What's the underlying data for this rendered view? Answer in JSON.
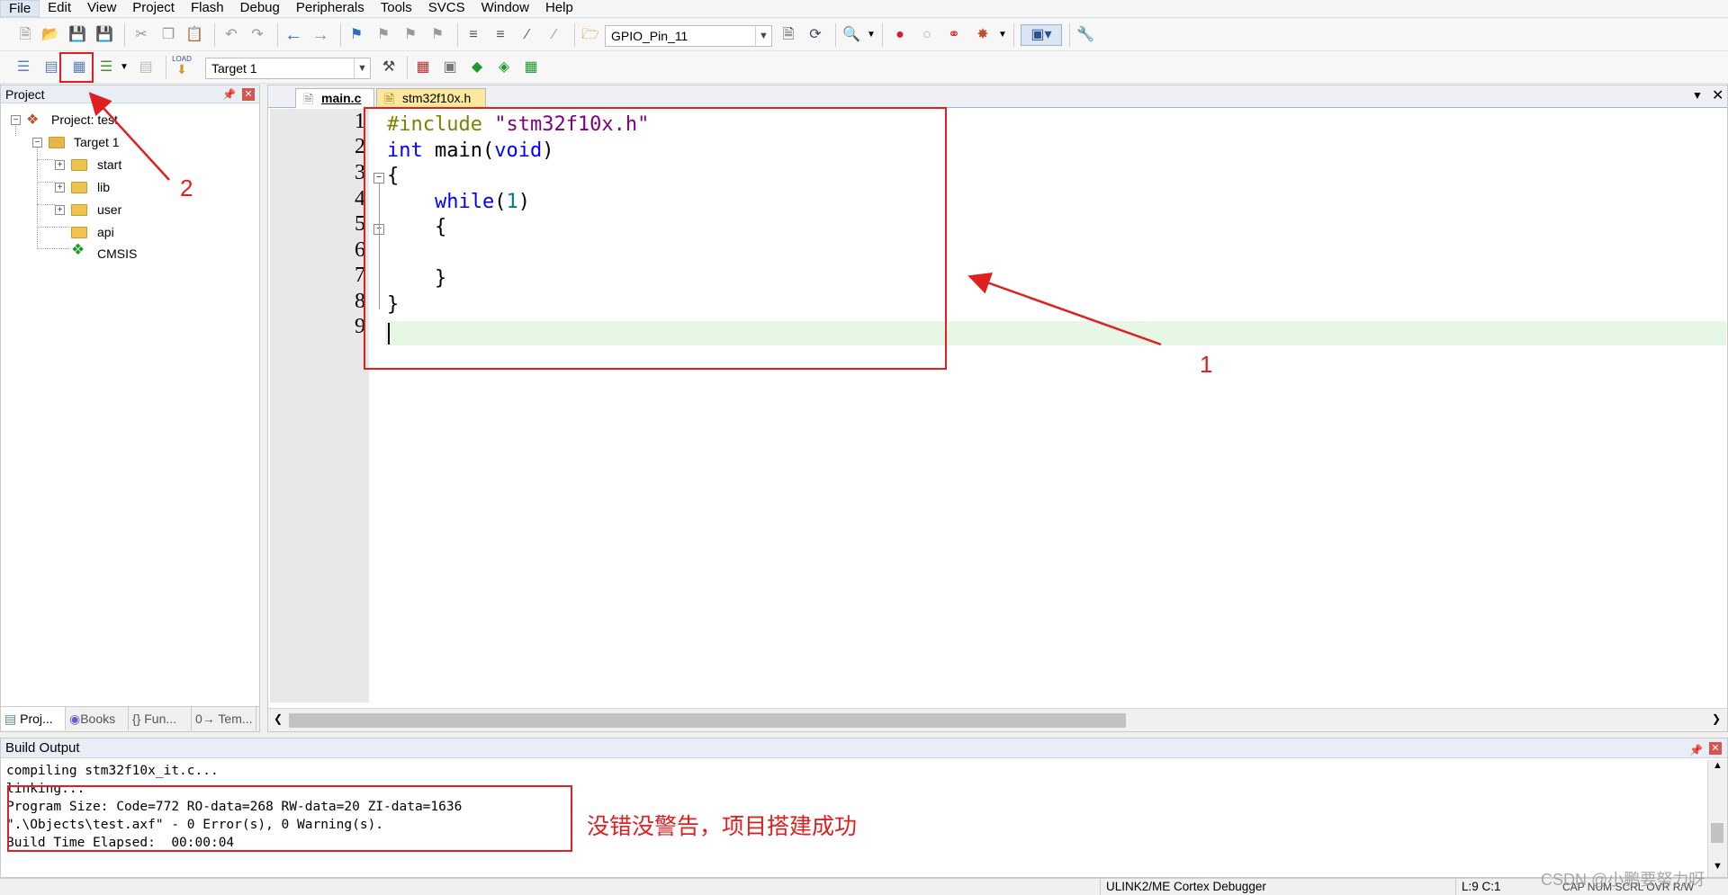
{
  "menu": [
    "File",
    "Edit",
    "View",
    "Project",
    "Flash",
    "Debug",
    "Peripherals",
    "Tools",
    "SVCS",
    "Window",
    "Help"
  ],
  "toolbar": {
    "find_combo_value": "GPIO_Pin_11",
    "target_combo_value": "Target 1",
    "load_label": "LOAD"
  },
  "project_panel": {
    "title": "Project",
    "root": "Project: test",
    "target": "Target 1",
    "groups": [
      "start",
      "lib",
      "user",
      "api"
    ],
    "cmsis": "CMSIS",
    "tabs": [
      "Proj...",
      "Books",
      "{} Fun...",
      "0→ Tem..."
    ]
  },
  "editor": {
    "tabs": [
      "main.c",
      "stm32f10x.h"
    ],
    "active_tab": "main.c",
    "line_numbers": [
      "1",
      "2",
      "3",
      "4",
      "5",
      "6",
      "7",
      "8",
      "9"
    ],
    "code": {
      "l1_directive": "#include ",
      "l1_file": "\"stm32f10x.h\"",
      "l2_int": "int",
      "l2_mid": " main(",
      "l2_void": "void",
      "l2_end": ")",
      "l3": "{",
      "l4_while": "while",
      "l4_open": "(",
      "l4_num": "1",
      "l4_close": ")",
      "l5": "{",
      "l7": "}",
      "l8": "}"
    }
  },
  "build_output": {
    "title": "Build Output",
    "lines": [
      "compiling stm32f10x_it.c...",
      "linking...",
      "Program Size: Code=772 RO-data=268 RW-data=20 ZI-data=1636",
      "\".\\Objects\\test.axf\" - 0 Error(s), 0 Warning(s).",
      "Build Time Elapsed:  00:00:04"
    ]
  },
  "annotations": {
    "label_1": "1",
    "label_2": "2",
    "success_note": "没错没警告，项目搭建成功"
  },
  "status_bar": {
    "debugger": "ULINK2/ME Cortex Debugger",
    "position": "L:9 C:1",
    "indicators": "CAP  NUM  SCRL  OVR  R/W",
    "watermark": "CSDN @小鹏要努力呀"
  },
  "colors": {
    "annotation_red": "#e02020",
    "keyword_blue": "#0000ff",
    "string_purple": "#800080",
    "preprocessor_olive": "#808000",
    "current_line": "#e6f7e6"
  }
}
